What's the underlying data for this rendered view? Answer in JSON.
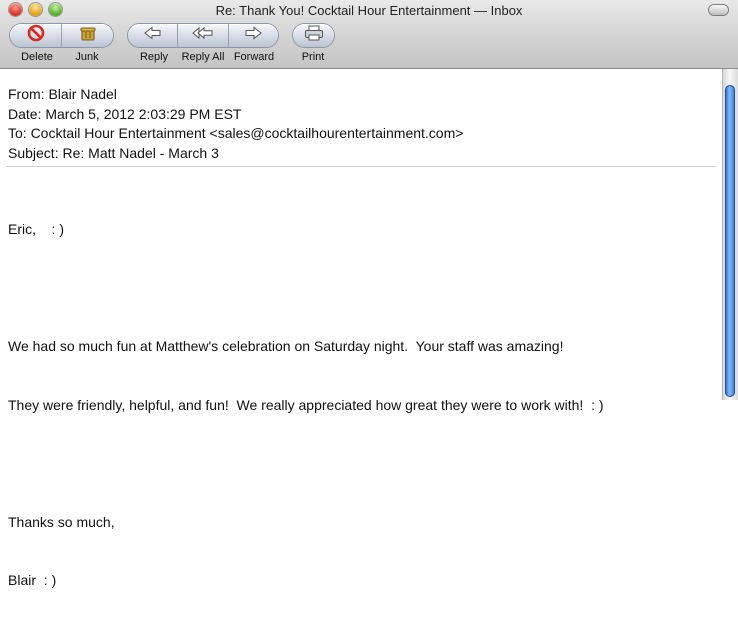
{
  "window": {
    "title": "Re: Thank You! Cocktail Hour Entertainment — Inbox"
  },
  "toolbar": {
    "delete_label": "Delete",
    "junk_label": "Junk",
    "reply_label": "Reply",
    "reply_all_label": "Reply All",
    "forward_label": "Forward",
    "print_label": "Print"
  },
  "message": {
    "from": "From: Blair Nadel",
    "date": "Date: March 5, 2012 2:03:29 PM EST",
    "to": "To: Cocktail Hour Entertainment <sales@cocktailhourentertainment.com>",
    "subject": "Subject: Re: Matt Nadel - March 3",
    "body": {
      "greeting": "Eric,    : )",
      "line1": "We had so much fun at Matthew's celebration on Saturday night.  Your staff was amazing!",
      "line2": "They were friendly, helpful, and fun!  We really appreciated how great they were to work with!  : )",
      "closing": "Thanks so much,",
      "signature": "Blair  : )"
    }
  },
  "colors": {
    "delete_icon": "#d62b1f",
    "scroll_thumb": "#3a7be0"
  },
  "icons": [
    "delete-icon",
    "junk-icon",
    "reply-icon",
    "reply-all-icon",
    "forward-icon",
    "print-icon"
  ]
}
